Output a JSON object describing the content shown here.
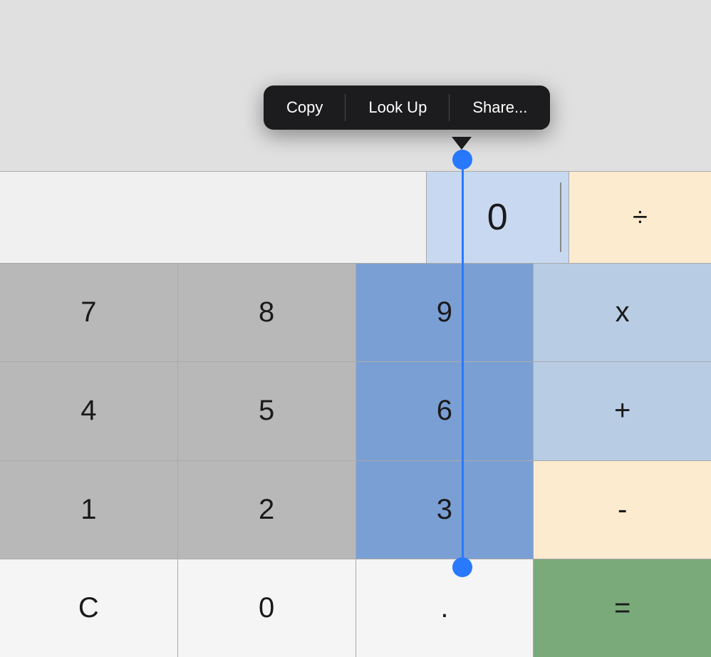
{
  "contextMenu": {
    "items": [
      "Copy",
      "Look Up",
      "Share..."
    ]
  },
  "display": {
    "value": "0",
    "operator": "÷"
  },
  "buttons": {
    "row1": [
      {
        "label": "7",
        "style": "gray"
      },
      {
        "label": "8",
        "style": "gray"
      },
      {
        "label": "9",
        "style": "blue-selected"
      },
      {
        "label": "x",
        "style": "blue-light"
      }
    ],
    "row2": [
      {
        "label": "4",
        "style": "gray"
      },
      {
        "label": "5",
        "style": "gray"
      },
      {
        "label": "6",
        "style": "blue-selected"
      },
      {
        "label": "+",
        "style": "blue-light"
      }
    ],
    "row3": [
      {
        "label": "1",
        "style": "gray"
      },
      {
        "label": "2",
        "style": "gray"
      },
      {
        "label": "3",
        "style": "blue-selected"
      },
      {
        "label": "-",
        "style": "orange-light"
      }
    ],
    "row4": [
      {
        "label": "C",
        "style": "white"
      },
      {
        "label": "0",
        "style": "white"
      },
      {
        "label": ".",
        "style": "white"
      },
      {
        "label": "=",
        "style": "green"
      }
    ]
  }
}
